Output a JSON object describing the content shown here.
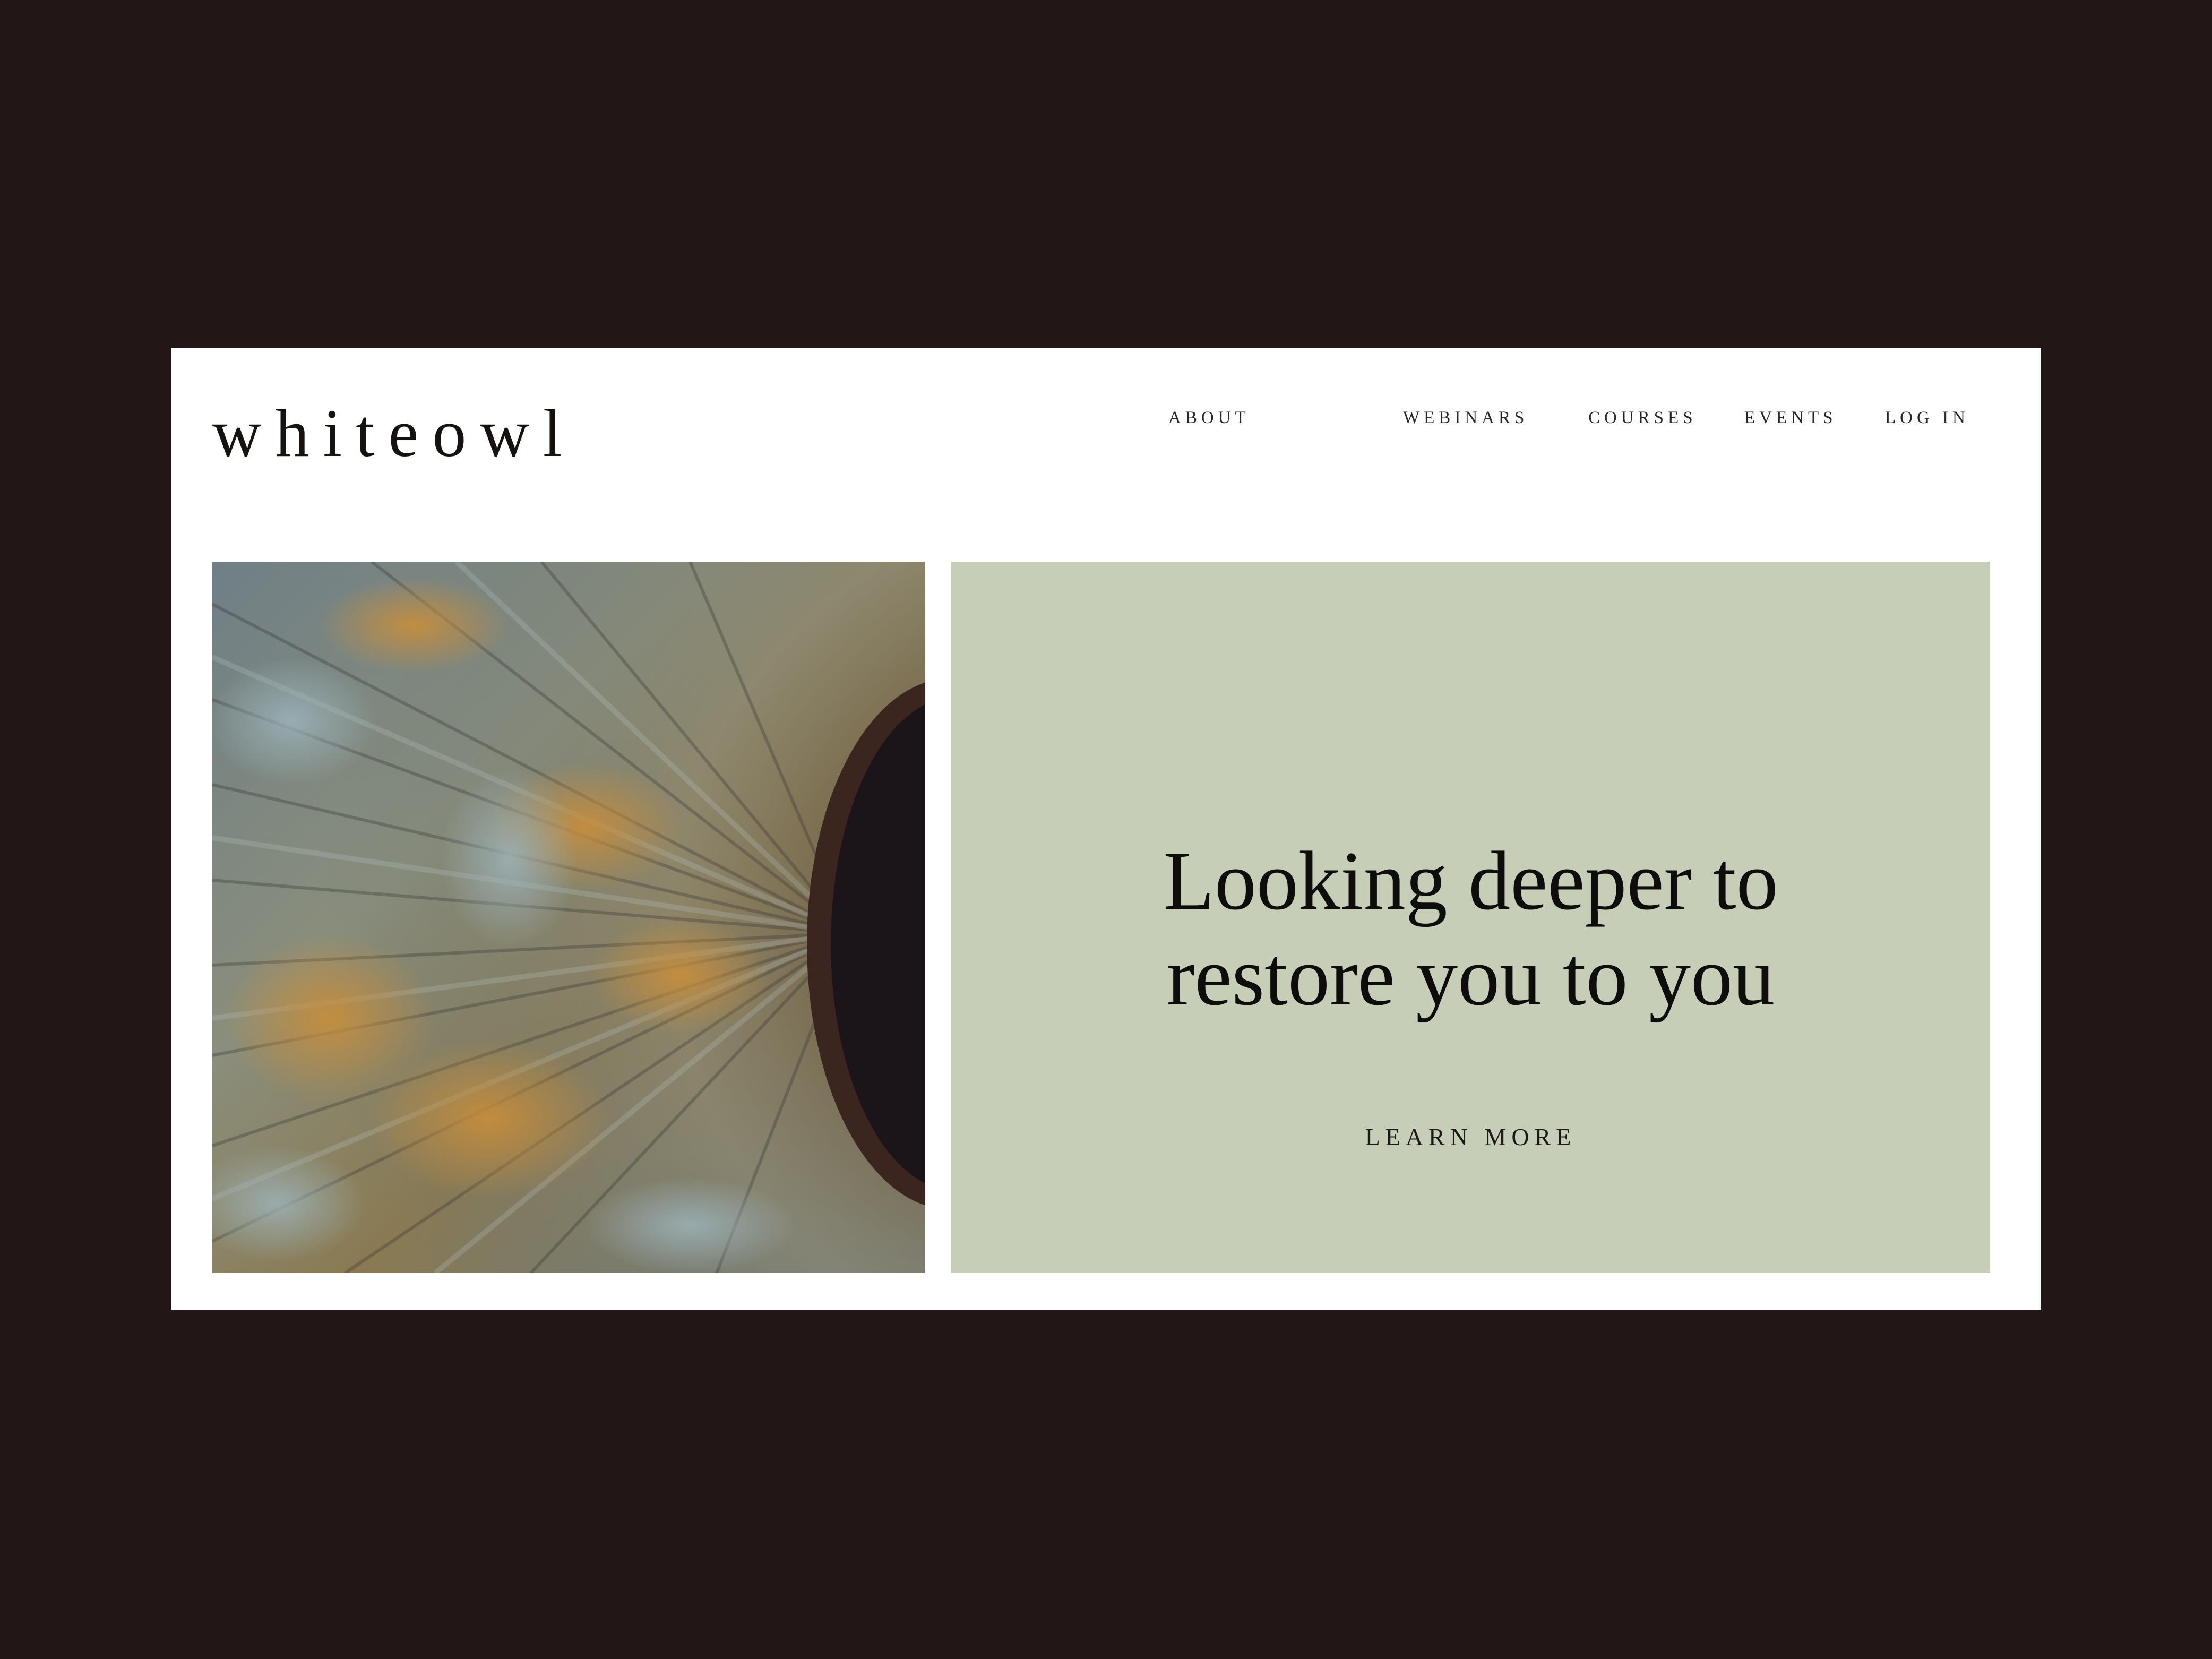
{
  "brand": {
    "logo_text": "whiteowl"
  },
  "nav": {
    "items": [
      {
        "label": "ABOUT"
      },
      {
        "label": "WEBINARS"
      },
      {
        "label": "COURSES"
      },
      {
        "label": "EVENTS"
      },
      {
        "label": "LOG IN"
      }
    ]
  },
  "hero": {
    "image_description_icon": "eye-iris-macro-photo",
    "headline_line1": "Looking deeper to",
    "headline_line2": "restore you to you",
    "cta_label": "LEARN MORE"
  },
  "colors": {
    "page_background": "#221716",
    "site_background": "#ffffff",
    "panel_sage": "#c6ceb7",
    "text_dark": "#0f0d0c"
  }
}
